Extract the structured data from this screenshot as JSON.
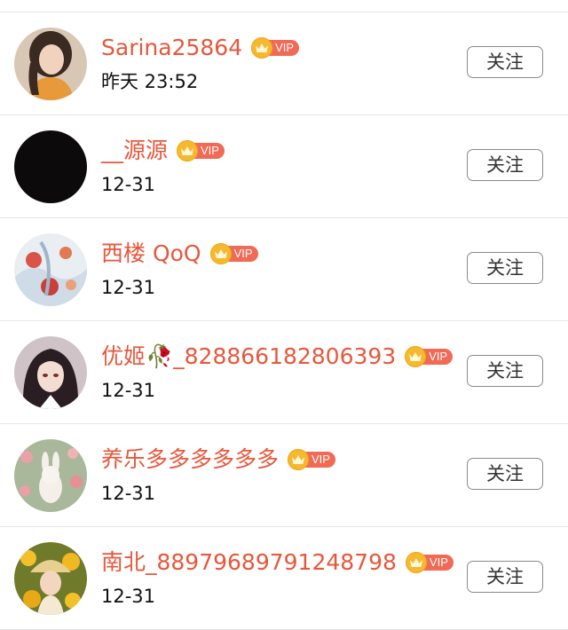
{
  "follow_label": "关注",
  "vip_label": "VIP",
  "colors": {
    "name": "#e8573b",
    "vip_badge": "#f06a55",
    "crown": "#f5b82e"
  },
  "users": [
    {
      "name": "Sarina25864",
      "time": "昨天 23:52",
      "vip": true,
      "avatar": "portrait-girl-orange"
    },
    {
      "name": "__源源",
      "time": "12-31",
      "vip": true,
      "avatar": "black-circle"
    },
    {
      "name": "西楼 QoQ",
      "time": "12-31",
      "vip": true,
      "avatar": "illustration-red-flowers"
    },
    {
      "name": "优姬🥀_828866182806393",
      "time": "12-31",
      "vip": true,
      "avatar": "anime-dark-hair"
    },
    {
      "name": "养乐多多多多多多",
      "time": "12-31",
      "vip": true,
      "avatar": "plush-rabbit-tulips"
    },
    {
      "name": "南北_88979689791248798",
      "time": "12-31",
      "vip": true,
      "avatar": "sunflower-girl"
    }
  ]
}
